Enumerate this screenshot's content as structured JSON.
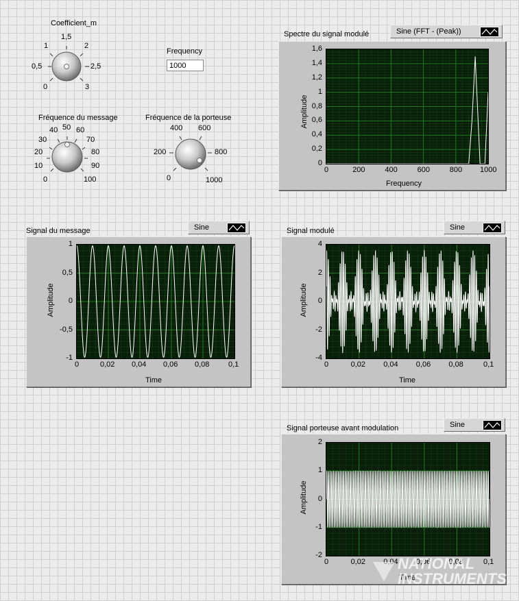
{
  "knobs": {
    "coefficient": {
      "label": "Coefficient_m",
      "value": 1.5,
      "scale": [
        "0",
        "0,5",
        "1",
        "1,5",
        "2",
        "2,5",
        "3"
      ]
    },
    "message_freq": {
      "label": "Fréquence du message",
      "value": 50,
      "scale": [
        "0",
        "10",
        "20",
        "30",
        "40",
        "50",
        "60",
        "70",
        "80",
        "90",
        "100"
      ]
    },
    "carrier_freq": {
      "label": "Fréquence de la porteuse",
      "value": 750,
      "scale": [
        "0",
        "200",
        "400",
        "600",
        "800",
        "1000"
      ]
    }
  },
  "frequency_control": {
    "label": "Frequency",
    "value": "1000"
  },
  "charts": {
    "spectrum": {
      "title": "Spectre du signal modulé",
      "legend": "Sine (FFT - (Peak))",
      "xlabel": "Frequency",
      "ylabel": "Amplitude",
      "x_ticks": [
        "0",
        "200",
        "400",
        "600",
        "800",
        "1000"
      ],
      "y_ticks": [
        "1,6",
        "1,4",
        "1,2",
        "1",
        "0,8",
        "0,6",
        "0,4",
        "0,2",
        "0"
      ]
    },
    "message": {
      "title": "Signal du message",
      "legend": "Sine",
      "xlabel": "Time",
      "ylabel": "Amplitude",
      "x_ticks": [
        "0",
        "0,02",
        "0,04",
        "0,06",
        "0,08",
        "0,1"
      ],
      "y_ticks": [
        "1",
        "0,5",
        "0",
        "-0,5",
        "-1"
      ]
    },
    "modulated": {
      "title": "Signal modulé",
      "legend": "Sine",
      "xlabel": "Time",
      "ylabel": "Amplitude",
      "x_ticks": [
        "0",
        "0,02",
        "0,04",
        "0,06",
        "0,08",
        "0,1"
      ],
      "y_ticks": [
        "4",
        "2",
        "0",
        "-2",
        "-4"
      ]
    },
    "carrier": {
      "title": "Signal porteuse avant modulation",
      "legend": "Sine",
      "xlabel": "Time",
      "ylabel": "Amplitude",
      "x_ticks": [
        "0",
        "0,02",
        "0,04",
        "0,06",
        "0,08",
        "0,1"
      ],
      "y_ticks": [
        "2",
        "1",
        "0",
        "-1",
        "-2"
      ]
    }
  },
  "watermark": "NATIONAL INSTRUMENTS",
  "colors": {
    "plot_bg": "#0a1f0a",
    "grid_major": "#1f7a1f",
    "grid_minor": "#123d12",
    "trace": "#ffffff"
  },
  "chart_data": [
    {
      "type": "line",
      "title": "Spectre du signal modulé",
      "xlabel": "Frequency",
      "ylabel": "Amplitude",
      "xlim": [
        0,
        1000
      ],
      "ylim": [
        0,
        1.6
      ],
      "x": [
        0,
        880,
        900,
        920,
        950,
        980,
        1000
      ],
      "series": [
        {
          "name": "Sine (FFT - (Peak))",
          "values": [
            0,
            0,
            0.6,
            1.5,
            0,
            0,
            1.0
          ]
        }
      ]
    },
    {
      "type": "line",
      "title": "Signal du message",
      "xlabel": "Time",
      "ylabel": "Amplitude",
      "xlim": [
        0,
        0.1
      ],
      "ylim": [
        -1,
        1
      ],
      "series": [
        {
          "name": "Sine",
          "function": "sin(2*pi*100*t)",
          "frequency": 100,
          "amplitude": 1
        }
      ]
    },
    {
      "type": "line",
      "title": "Signal modulé",
      "xlabel": "Time",
      "ylabel": "Amplitude",
      "xlim": [
        0,
        0.1
      ],
      "ylim": [
        -4,
        4
      ],
      "series": [
        {
          "name": "Sine",
          "message_frequency": 100,
          "carrier_frequency": 1000,
          "modulation_index": 1.5
        }
      ]
    },
    {
      "type": "line",
      "title": "Signal porteuse avant modulation",
      "xlabel": "Time",
      "ylabel": "Amplitude",
      "xlim": [
        0,
        0.1
      ],
      "ylim": [
        -2,
        2
      ],
      "series": [
        {
          "name": "Sine",
          "frequency": 1000,
          "amplitude": 1
        }
      ]
    }
  ]
}
